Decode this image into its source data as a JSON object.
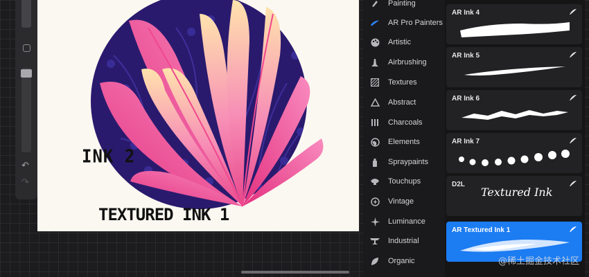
{
  "canvas": {
    "annotations": {
      "ink2": "INK 2",
      "textured": "TEXTURED INK 1"
    }
  },
  "categories": [
    {
      "label": "Painting",
      "icon": "painting-icon"
    },
    {
      "label": "AR Pro Painters",
      "icon": "ar-pro-painters-icon",
      "active": true
    },
    {
      "label": "Artistic",
      "icon": "artistic-palette-icon"
    },
    {
      "label": "Airbrushing",
      "icon": "airbrushing-icon"
    },
    {
      "label": "Textures",
      "icon": "textures-icon"
    },
    {
      "label": "Abstract",
      "icon": "abstract-icon"
    },
    {
      "label": "Charcoals",
      "icon": "charcoals-icon"
    },
    {
      "label": "Elements",
      "icon": "elements-icon"
    },
    {
      "label": "Spraypaints",
      "icon": "spraypaints-icon"
    },
    {
      "label": "Touchups",
      "icon": "touchups-icon"
    },
    {
      "label": "Vintage",
      "icon": "vintage-icon"
    },
    {
      "label": "Luminance",
      "icon": "luminance-icon"
    },
    {
      "label": "Industrial",
      "icon": "industrial-icon"
    },
    {
      "label": "Organic",
      "icon": "organic-icon"
    }
  ],
  "brushes": [
    {
      "name": "AR Ink 4"
    },
    {
      "name": "AR Ink 5"
    },
    {
      "name": "AR Ink 6"
    },
    {
      "name": "AR Ink 7"
    },
    {
      "name": "D2L",
      "preview_text": "Textured Ink"
    },
    {
      "name": "AR Textured Ink 1",
      "selected": true
    }
  ],
  "watermark": "@稀土掘金技术社区",
  "colors": {
    "accent": "#1c7cf2",
    "artwork_navy": "#2a1a6e",
    "artwork_pink": "#f0478f",
    "artwork_peach": "#ffd9a8"
  }
}
